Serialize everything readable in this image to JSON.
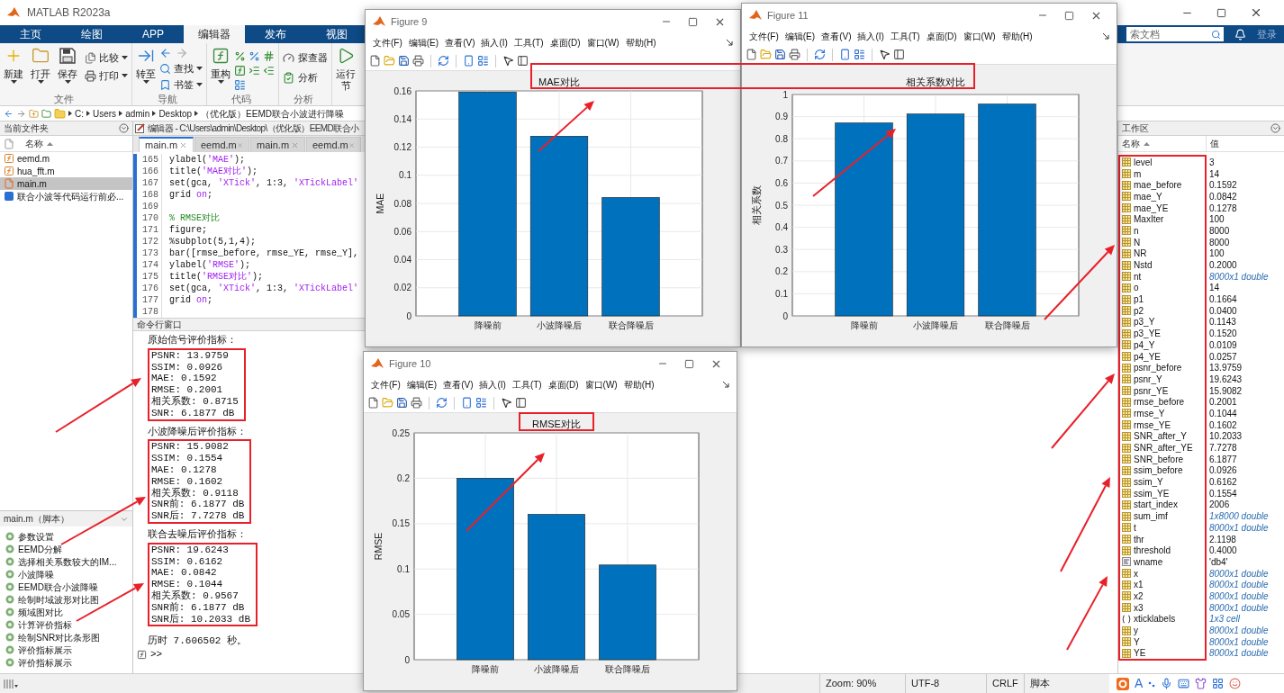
{
  "title": "MATLAB R2023a",
  "ribbon_tabs": [
    {
      "label": "主页",
      "selected": false
    },
    {
      "label": "绘图",
      "selected": false
    },
    {
      "label": "APP",
      "selected": false
    },
    {
      "label": "编辑器",
      "selected": true
    },
    {
      "label": "发布",
      "selected": false
    },
    {
      "label": "视图",
      "selected": false
    }
  ],
  "search": {
    "placeholder": "索文档"
  },
  "sign_in": "登录",
  "ribbon_groups": [
    {
      "label": "文件",
      "items": [
        "新建",
        "打开",
        "保存",
        "比较",
        "打印"
      ]
    },
    {
      "label": "导航",
      "items": [
        "转至",
        "查找",
        "书签"
      ]
    },
    {
      "label": "代码",
      "items": [
        "重构"
      ]
    },
    {
      "label": "分析",
      "items": [
        "探查器",
        "分析"
      ]
    }
  ],
  "run_section": "运行节",
  "address_path": [
    "C:",
    "Users",
    "admin",
    "Desktop",
    "（优化版）EEMD联合小波进行降噪"
  ],
  "current_folder": {
    "title": "当前文件夹",
    "column": "名称",
    "files": [
      {
        "name": "eemd.m",
        "kind": "function",
        "selected": false
      },
      {
        "name": "hua_fft.m",
        "kind": "function",
        "selected": false
      },
      {
        "name": "main.m",
        "kind": "script",
        "selected": true
      },
      {
        "name": "联合小波等代码运行前必...",
        "kind": "document",
        "selected": false
      }
    ]
  },
  "sections_panel": {
    "title": "main.m（脚本）",
    "sections": [
      "参数设置",
      "EEMD分解",
      "选择相关系数较大的IM...",
      "小波降噪",
      "EEMD联合小波降噪",
      "绘制时域波形对比图",
      "频域图对比",
      "计算评价指标",
      "绘制SNR对比条形图",
      "评价指标展示",
      "评价指标展示"
    ]
  },
  "editor": {
    "title": "编辑器 - C:\\Users\\admin\\Desktop\\（优化版）EEMD联合小",
    "tabs": [
      {
        "label": "main.m",
        "selected": true
      },
      {
        "label": "eemd.m",
        "selected": false
      },
      {
        "label": "main.m",
        "selected": false
      },
      {
        "label": "eemd.m",
        "selected": false
      }
    ],
    "lines": [
      {
        "number": "165",
        "parts": [
          {
            "kind": "code",
            "text": "ylabel("
          },
          {
            "kind": "string",
            "text": "'MAE'"
          },
          {
            "kind": "code",
            "text": ");"
          }
        ]
      },
      {
        "number": "166",
        "parts": [
          {
            "kind": "code",
            "text": "title("
          },
          {
            "kind": "string",
            "text": "'MAE对比'"
          },
          {
            "kind": "code",
            "text": ");"
          }
        ]
      },
      {
        "number": "167",
        "parts": [
          {
            "kind": "code",
            "text": "set(gca, "
          },
          {
            "kind": "string",
            "text": "'XTick'"
          },
          {
            "kind": "code",
            "text": ", 1:3, "
          },
          {
            "kind": "string",
            "text": "'XTickLabel'"
          }
        ]
      },
      {
        "number": "168",
        "parts": [
          {
            "kind": "code",
            "text": "grid "
          },
          {
            "kind": "string",
            "text": "on"
          },
          {
            "kind": "code",
            "text": ";"
          }
        ]
      },
      {
        "number": "169"
      },
      {
        "number": "170",
        "parts": [
          {
            "kind": "comment",
            "text": "% RMSE对比"
          }
        ]
      },
      {
        "number": "171",
        "parts": [
          {
            "kind": "code",
            "text": "figure;"
          }
        ]
      },
      {
        "number": "172",
        "parts": [
          {
            "kind": "code",
            "text": "%subplot(5,1,4);"
          }
        ]
      },
      {
        "number": "173",
        "parts": [
          {
            "kind": "code",
            "text": "bar([rmse_before, rmse_YE, rmse_Y],"
          }
        ]
      },
      {
        "number": "174",
        "parts": [
          {
            "kind": "code",
            "text": "ylabel("
          },
          {
            "kind": "string",
            "text": "'RMSE'"
          },
          {
            "kind": "code",
            "text": ");"
          }
        ]
      },
      {
        "number": "175",
        "parts": [
          {
            "kind": "code",
            "text": "title("
          },
          {
            "kind": "string",
            "text": "'RMSE对比'"
          },
          {
            "kind": "code",
            "text": ");"
          }
        ]
      },
      {
        "number": "176",
        "parts": [
          {
            "kind": "code",
            "text": "set(gca, "
          },
          {
            "kind": "string",
            "text": "'XTick'"
          },
          {
            "kind": "code",
            "text": ", 1:3, "
          },
          {
            "kind": "string",
            "text": "'XTickLabel'"
          }
        ]
      },
      {
        "number": "177",
        "parts": [
          {
            "kind": "code",
            "text": "grid "
          },
          {
            "kind": "string",
            "text": "on"
          },
          {
            "kind": "code",
            "text": ";"
          }
        ]
      },
      {
        "number": "178"
      }
    ]
  },
  "command_window": {
    "title": "命令行窗口",
    "blocks": [
      {
        "heading": "原始信号评价指标：",
        "highlighted": true,
        "lines": [
          "PSNR: 13.9759",
          "SSIM: 0.0926",
          "MAE: 0.1592",
          "RMSE: 0.2001",
          "相关系数: 0.8715",
          "SNR: 6.1877 dB"
        ]
      },
      {
        "heading": "小波降噪后评价指标：",
        "highlighted": true,
        "lines": [
          "PSNR: 15.9082",
          "SSIM: 0.1554",
          "MAE: 0.1278",
          "RMSE: 0.1602",
          "相关系数: 0.9118",
          "SNR前: 6.1877 dB",
          "SNR后: 7.7278 dB"
        ]
      },
      {
        "heading": "联合去噪后评价指标：",
        "highlighted": true,
        "lines": [
          "PSNR: 19.6243",
          "SSIM: 0.6162",
          "MAE: 0.0842",
          "RMSE: 0.1044",
          "相关系数: 0.9567",
          "SNR前: 6.1877 dB",
          "SNR后: 10.2033 dB"
        ]
      }
    ],
    "elapsed": "历时 7.606502 秒。",
    "prompt": ">>"
  },
  "workspace": {
    "title": "工作区",
    "columns": [
      "名称",
      "值"
    ],
    "variables": [
      {
        "name": "level",
        "value": "3",
        "kind": "matrix",
        "summary": false
      },
      {
        "name": "m",
        "value": "14",
        "kind": "matrix",
        "summary": false
      },
      {
        "name": "mae_before",
        "value": "0.1592",
        "kind": "matrix",
        "summary": false
      },
      {
        "name": "mae_Y",
        "value": "0.0842",
        "kind": "matrix",
        "summary": false
      },
      {
        "name": "mae_YE",
        "value": "0.1278",
        "kind": "matrix",
        "summary": false
      },
      {
        "name": "MaxIter",
        "value": "100",
        "kind": "matrix",
        "summary": false
      },
      {
        "name": "n",
        "value": "8000",
        "kind": "matrix",
        "summary": false
      },
      {
        "name": "N",
        "value": "8000",
        "kind": "matrix",
        "summary": false
      },
      {
        "name": "NR",
        "value": "100",
        "kind": "matrix",
        "summary": false
      },
      {
        "name": "Nstd",
        "value": "0.2000",
        "kind": "matrix",
        "summary": false
      },
      {
        "name": "nt",
        "value": "8000x1 double",
        "kind": "matrix",
        "summary": true
      },
      {
        "name": "o",
        "value": "14",
        "kind": "matrix",
        "summary": false
      },
      {
        "name": "p1",
        "value": "0.1664",
        "kind": "matrix",
        "summary": false
      },
      {
        "name": "p2",
        "value": "0.0400",
        "kind": "matrix",
        "summary": false
      },
      {
        "name": "p3_Y",
        "value": "0.1143",
        "kind": "matrix",
        "summary": false
      },
      {
        "name": "p3_YE",
        "value": "0.1520",
        "kind": "matrix",
        "summary": false
      },
      {
        "name": "p4_Y",
        "value": "0.0109",
        "kind": "matrix",
        "summary": false
      },
      {
        "name": "p4_YE",
        "value": "0.0257",
        "kind": "matrix",
        "summary": false
      },
      {
        "name": "psnr_before",
        "value": "13.9759",
        "kind": "matrix",
        "summary": false
      },
      {
        "name": "psnr_Y",
        "value": "19.6243",
        "kind": "matrix",
        "summary": false
      },
      {
        "name": "psnr_YE",
        "value": "15.9082",
        "kind": "matrix",
        "summary": false
      },
      {
        "name": "rmse_before",
        "value": "0.2001",
        "kind": "matrix",
        "summary": false
      },
      {
        "name": "rmse_Y",
        "value": "0.1044",
        "kind": "matrix",
        "summary": false
      },
      {
        "name": "rmse_YE",
        "value": "0.1602",
        "kind": "matrix",
        "summary": false
      },
      {
        "name": "SNR_after_Y",
        "value": "10.2033",
        "kind": "matrix",
        "summary": false
      },
      {
        "name": "SNR_after_YE",
        "value": "7.7278",
        "kind": "matrix",
        "summary": false
      },
      {
        "name": "SNR_before",
        "value": "6.1877",
        "kind": "matrix",
        "summary": false
      },
      {
        "name": "ssim_before",
        "value": "0.0926",
        "kind": "matrix",
        "summary": false
      },
      {
        "name": "ssim_Y",
        "value": "0.6162",
        "kind": "matrix",
        "summary": false
      },
      {
        "name": "ssim_YE",
        "value": "0.1554",
        "kind": "matrix",
        "summary": false
      },
      {
        "name": "start_index",
        "value": "2006",
        "kind": "matrix",
        "summary": false
      },
      {
        "name": "sum_imf",
        "value": "1x8000 double",
        "kind": "matrix",
        "summary": true
      },
      {
        "name": "t",
        "value": "8000x1 double",
        "kind": "matrix",
        "summary": true
      },
      {
        "name": "thr",
        "value": "2.1198",
        "kind": "matrix",
        "summary": false
      },
      {
        "name": "threshold",
        "value": "0.4000",
        "kind": "matrix",
        "summary": false
      },
      {
        "name": "wname",
        "value": "'db4'",
        "kind": "char",
        "summary": false
      },
      {
        "name": "x",
        "value": "8000x1 double",
        "kind": "matrix",
        "summary": true
      },
      {
        "name": "x1",
        "value": "8000x1 double",
        "kind": "matrix",
        "summary": true
      },
      {
        "name": "x2",
        "value": "8000x1 double",
        "kind": "matrix",
        "summary": true
      },
      {
        "name": "x3",
        "value": "8000x1 double",
        "kind": "matrix",
        "summary": true
      },
      {
        "name": "xticklabels",
        "value": "1x3 cell",
        "kind": "cell",
        "summary": true
      },
      {
        "name": "y",
        "value": "8000x1 double",
        "kind": "matrix",
        "summary": true
      },
      {
        "name": "Y",
        "value": "8000x1 double",
        "kind": "matrix",
        "summary": true
      },
      {
        "name": "YE",
        "value": "8000x1 double",
        "kind": "matrix",
        "summary": true
      }
    ]
  },
  "status_bar": {
    "cells": [
      "Zoom: 90%",
      "UTF-8",
      "CRLF",
      "脚本"
    ],
    "ime_letter": "A"
  },
  "figures": [
    {
      "title": "Figure 9",
      "menus": [
        "文件(F)",
        "编辑(E)",
        "查看(V)",
        "插入(I)",
        "工具(T)",
        "桌面(D)",
        "窗口(W)",
        "帮助(H)"
      ],
      "chart_data": {
        "type": "bar",
        "title": "MAE对比",
        "ylabel": "MAE",
        "categories": [
          "降噪前",
          "小波降噪后",
          "联合降噪后"
        ],
        "values": [
          0.1592,
          0.1278,
          0.0842
        ],
        "grid": true,
        "ylim": [
          0,
          0.16
        ],
        "yticks": [
          0,
          0.02,
          0.04,
          0.06,
          0.08,
          0.1,
          0.12,
          0.14,
          0.16
        ]
      }
    },
    {
      "title": "Figure 11",
      "menus": [
        "文件(F)",
        "编辑(E)",
        "查看(V)",
        "插入(I)",
        "工具(T)",
        "桌面(D)",
        "窗口(W)",
        "帮助(H)"
      ],
      "chart_data": {
        "type": "bar",
        "title": "相关系数对比",
        "ylabel": "相关系数",
        "categories": [
          "降噪前",
          "小波降噪后",
          "联合降噪后"
        ],
        "values": [
          0.8715,
          0.9118,
          0.9567
        ],
        "grid": true,
        "ylim": [
          0,
          1
        ],
        "yticks": [
          0,
          0.1,
          0.2,
          0.3,
          0.4,
          0.5,
          0.6,
          0.7,
          0.8,
          0.9,
          1
        ]
      }
    },
    {
      "title": "Figure 10",
      "menus": [
        "文件(F)",
        "编辑(E)",
        "查看(V)",
        "插入(I)",
        "工具(T)",
        "桌面(D)",
        "窗口(W)",
        "帮助(H)"
      ],
      "chart_data": {
        "type": "bar",
        "title": "RMSE对比",
        "ylabel": "RMSE",
        "categories": [
          "降噪前",
          "小波降噪后",
          "联合降噪后"
        ],
        "values": [
          0.2001,
          0.1602,
          0.1044
        ],
        "grid": true,
        "ylim": [
          0,
          0.25
        ],
        "yticks": [
          0,
          0.05,
          0.1,
          0.15,
          0.2,
          0.25
        ]
      }
    }
  ]
}
